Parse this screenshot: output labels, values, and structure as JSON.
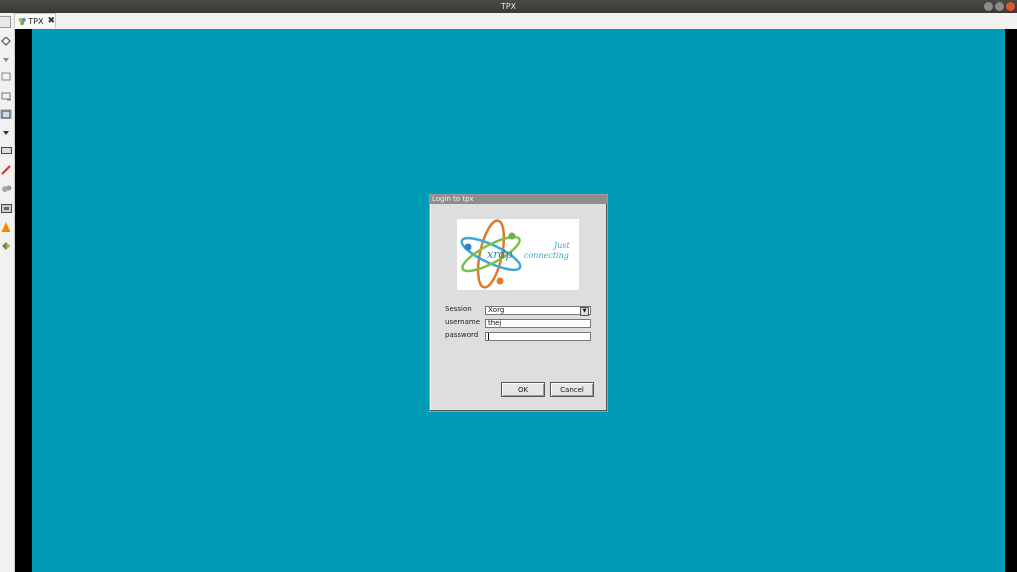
{
  "window": {
    "title": "TPX"
  },
  "tab": {
    "label": "TPX"
  },
  "dialog": {
    "title": "Login to tpx",
    "logo": {
      "brand": "xrdp",
      "line1": "Just",
      "line2": "connecting"
    },
    "fields": {
      "session_label": "Session",
      "session_value": "Xorg",
      "username_label": "username",
      "username_value": "thej",
      "password_label": "password",
      "password_value": ""
    },
    "buttons": {
      "ok": "OK",
      "cancel": "Cancel"
    }
  },
  "colors": {
    "desktop": "#009bb5",
    "dialog": "#dedede",
    "titlebar": "#3a3936"
  }
}
